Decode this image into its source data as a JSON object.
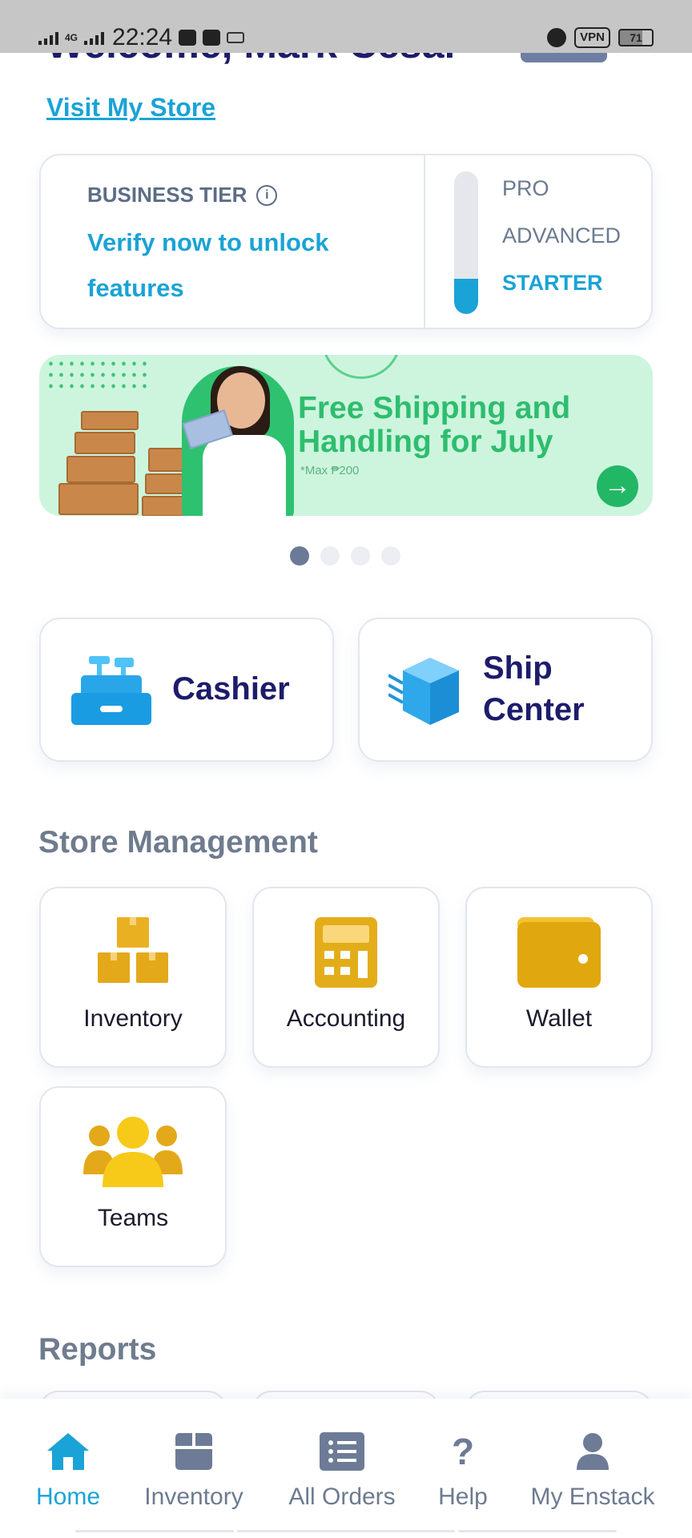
{
  "status_bar": {
    "network": "4G",
    "time": "22:24",
    "vpn": "VPN",
    "battery": "71"
  },
  "header": {
    "welcome": "Welcome, Mark Cesar",
    "visit_store": "Visit My Store"
  },
  "tier": {
    "label": "BUSINESS TIER",
    "cta": "Verify now to unlock features",
    "levels": [
      "PRO",
      "ADVANCED",
      "STARTER"
    ],
    "current_level": "STARTER",
    "progress": 0.25
  },
  "banner": {
    "title": "Free Shipping and Handling for July",
    "note": "*Max ₱200",
    "slide_count": 4,
    "active_slide": 1
  },
  "actions": {
    "cashier": "Cashier",
    "ship_center_line1": "Ship",
    "ship_center_line2": "Center"
  },
  "store_management": {
    "title": "Store Management",
    "tiles": [
      {
        "label": "Inventory",
        "icon": "boxes-icon"
      },
      {
        "label": "Accounting",
        "icon": "calculator-icon"
      },
      {
        "label": "Wallet",
        "icon": "wallet-icon"
      },
      {
        "label": "Teams",
        "icon": "team-icon"
      }
    ]
  },
  "reports": {
    "title": "Reports"
  },
  "bottom_nav": [
    {
      "label": "Home",
      "icon": "home-icon",
      "active": true
    },
    {
      "label": "Inventory",
      "icon": "box-icon",
      "active": false
    },
    {
      "label": "All Orders",
      "icon": "list-icon",
      "active": false
    },
    {
      "label": "Help",
      "icon": "question-icon",
      "active": false
    },
    {
      "label": "My Enstack",
      "icon": "user-icon",
      "active": false
    }
  ],
  "colors": {
    "accent": "#1aa3d6",
    "brand_navy": "#1d1c6b",
    "banner_green": "#2ebd6e",
    "tile_gold": "#e3ad1a"
  }
}
